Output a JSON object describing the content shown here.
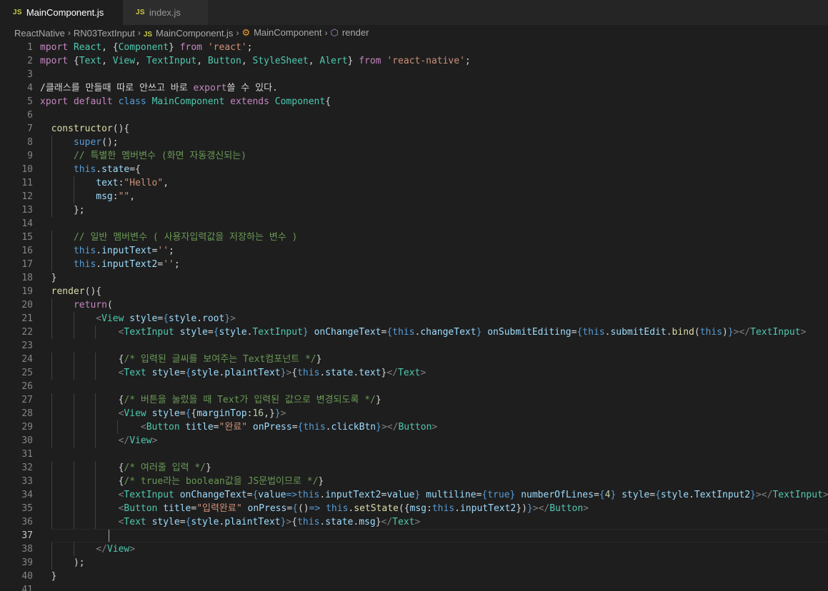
{
  "tabs": [
    {
      "icon": "JS",
      "label": "MainComponent.js",
      "active": true
    },
    {
      "icon": "JS",
      "label": "index.js",
      "active": false
    }
  ],
  "breadcrumb": {
    "folder1": "ReactNative",
    "folder2": "RN03TextInput",
    "file_icon": "JS",
    "file": "MainComponent.js",
    "class": "MainComponent",
    "method": "render"
  },
  "editor": {
    "current_line": 37,
    "lines": [
      {
        "n": "1",
        "text": "mport React, {Component} from 'react';"
      },
      {
        "n": "2",
        "text": "mport {Text, View, TextInput, Button, StyleSheet, Alert} from 'react-native';"
      },
      {
        "n": "3",
        "text": ""
      },
      {
        "n": "4",
        "text": "/클래스를 만들때 따로 안쓰고 바로 export쓸 수 있다."
      },
      {
        "n": "5",
        "text": "xport default class MainComponent extends Component{"
      },
      {
        "n": "6",
        "text": ""
      },
      {
        "n": "7",
        "text": "  constructor(){"
      },
      {
        "n": "8",
        "text": "      super();"
      },
      {
        "n": "9",
        "text": "      // 특별한 멤버변수 (화면 자동갱신되는)"
      },
      {
        "n": "10",
        "text": "      this.state={"
      },
      {
        "n": "11",
        "text": "          text:\"Hello\","
      },
      {
        "n": "12",
        "text": "          msg:\"\","
      },
      {
        "n": "13",
        "text": "      };"
      },
      {
        "n": "14",
        "text": ""
      },
      {
        "n": "15",
        "text": "      // 일반 멤버변수 ( 사용자입력값을 저장하는 변수 )"
      },
      {
        "n": "16",
        "text": "      this.inputText='';"
      },
      {
        "n": "17",
        "text": "      this.inputText2='';"
      },
      {
        "n": "18",
        "text": "  }"
      },
      {
        "n": "19",
        "text": "  render(){"
      },
      {
        "n": "20",
        "text": "      return("
      },
      {
        "n": "21",
        "text": "          <View style={style.root}>"
      },
      {
        "n": "22",
        "text": "              <TextInput style={style.TextInput} onChangeText={this.changeText} onSubmitEditing={this.submitEdit.bind(this)}></TextInput>"
      },
      {
        "n": "23",
        "text": ""
      },
      {
        "n": "24",
        "text": "              {/* 입력된 글씨를 보여주는 Text컴포넌트 */}"
      },
      {
        "n": "25",
        "text": "              <Text style={style.plaintText}>{this.state.text}</Text>"
      },
      {
        "n": "26",
        "text": ""
      },
      {
        "n": "27",
        "text": "              {/* 버튼을 눌렀을 때 Text가 입력된 값으로 변경되도록 */}"
      },
      {
        "n": "28",
        "text": "              <View style={{marginTop:16,}}>"
      },
      {
        "n": "29",
        "text": "                  <Button title=\"완료\" onPress={this.clickBtn}></Button>"
      },
      {
        "n": "30",
        "text": "              </View>"
      },
      {
        "n": "31",
        "text": ""
      },
      {
        "n": "32",
        "text": "              {/* 여러줄 입력 */}"
      },
      {
        "n": "33",
        "text": "              {/* true라는 boolean값을 JS문법이므로 */}"
      },
      {
        "n": "34",
        "text": "              <TextInput onChangeText={value=>this.inputText2=value} multiline={true} numberOfLines={4} style={style.TextInput2}></TextInput>"
      },
      {
        "n": "35",
        "text": "              <Button title=\"입력완료\" onPress={()=> this.setState({msg:this.inputText2})}></Button>"
      },
      {
        "n": "36",
        "text": "              <Text style={style.plaintText}>{this.state.msg}</Text>"
      },
      {
        "n": "37",
        "text": ""
      },
      {
        "n": "38",
        "text": "          </View>"
      },
      {
        "n": "39",
        "text": "      );"
      },
      {
        "n": "40",
        "text": "  }"
      },
      {
        "n": "41",
        "text": ""
      }
    ]
  }
}
